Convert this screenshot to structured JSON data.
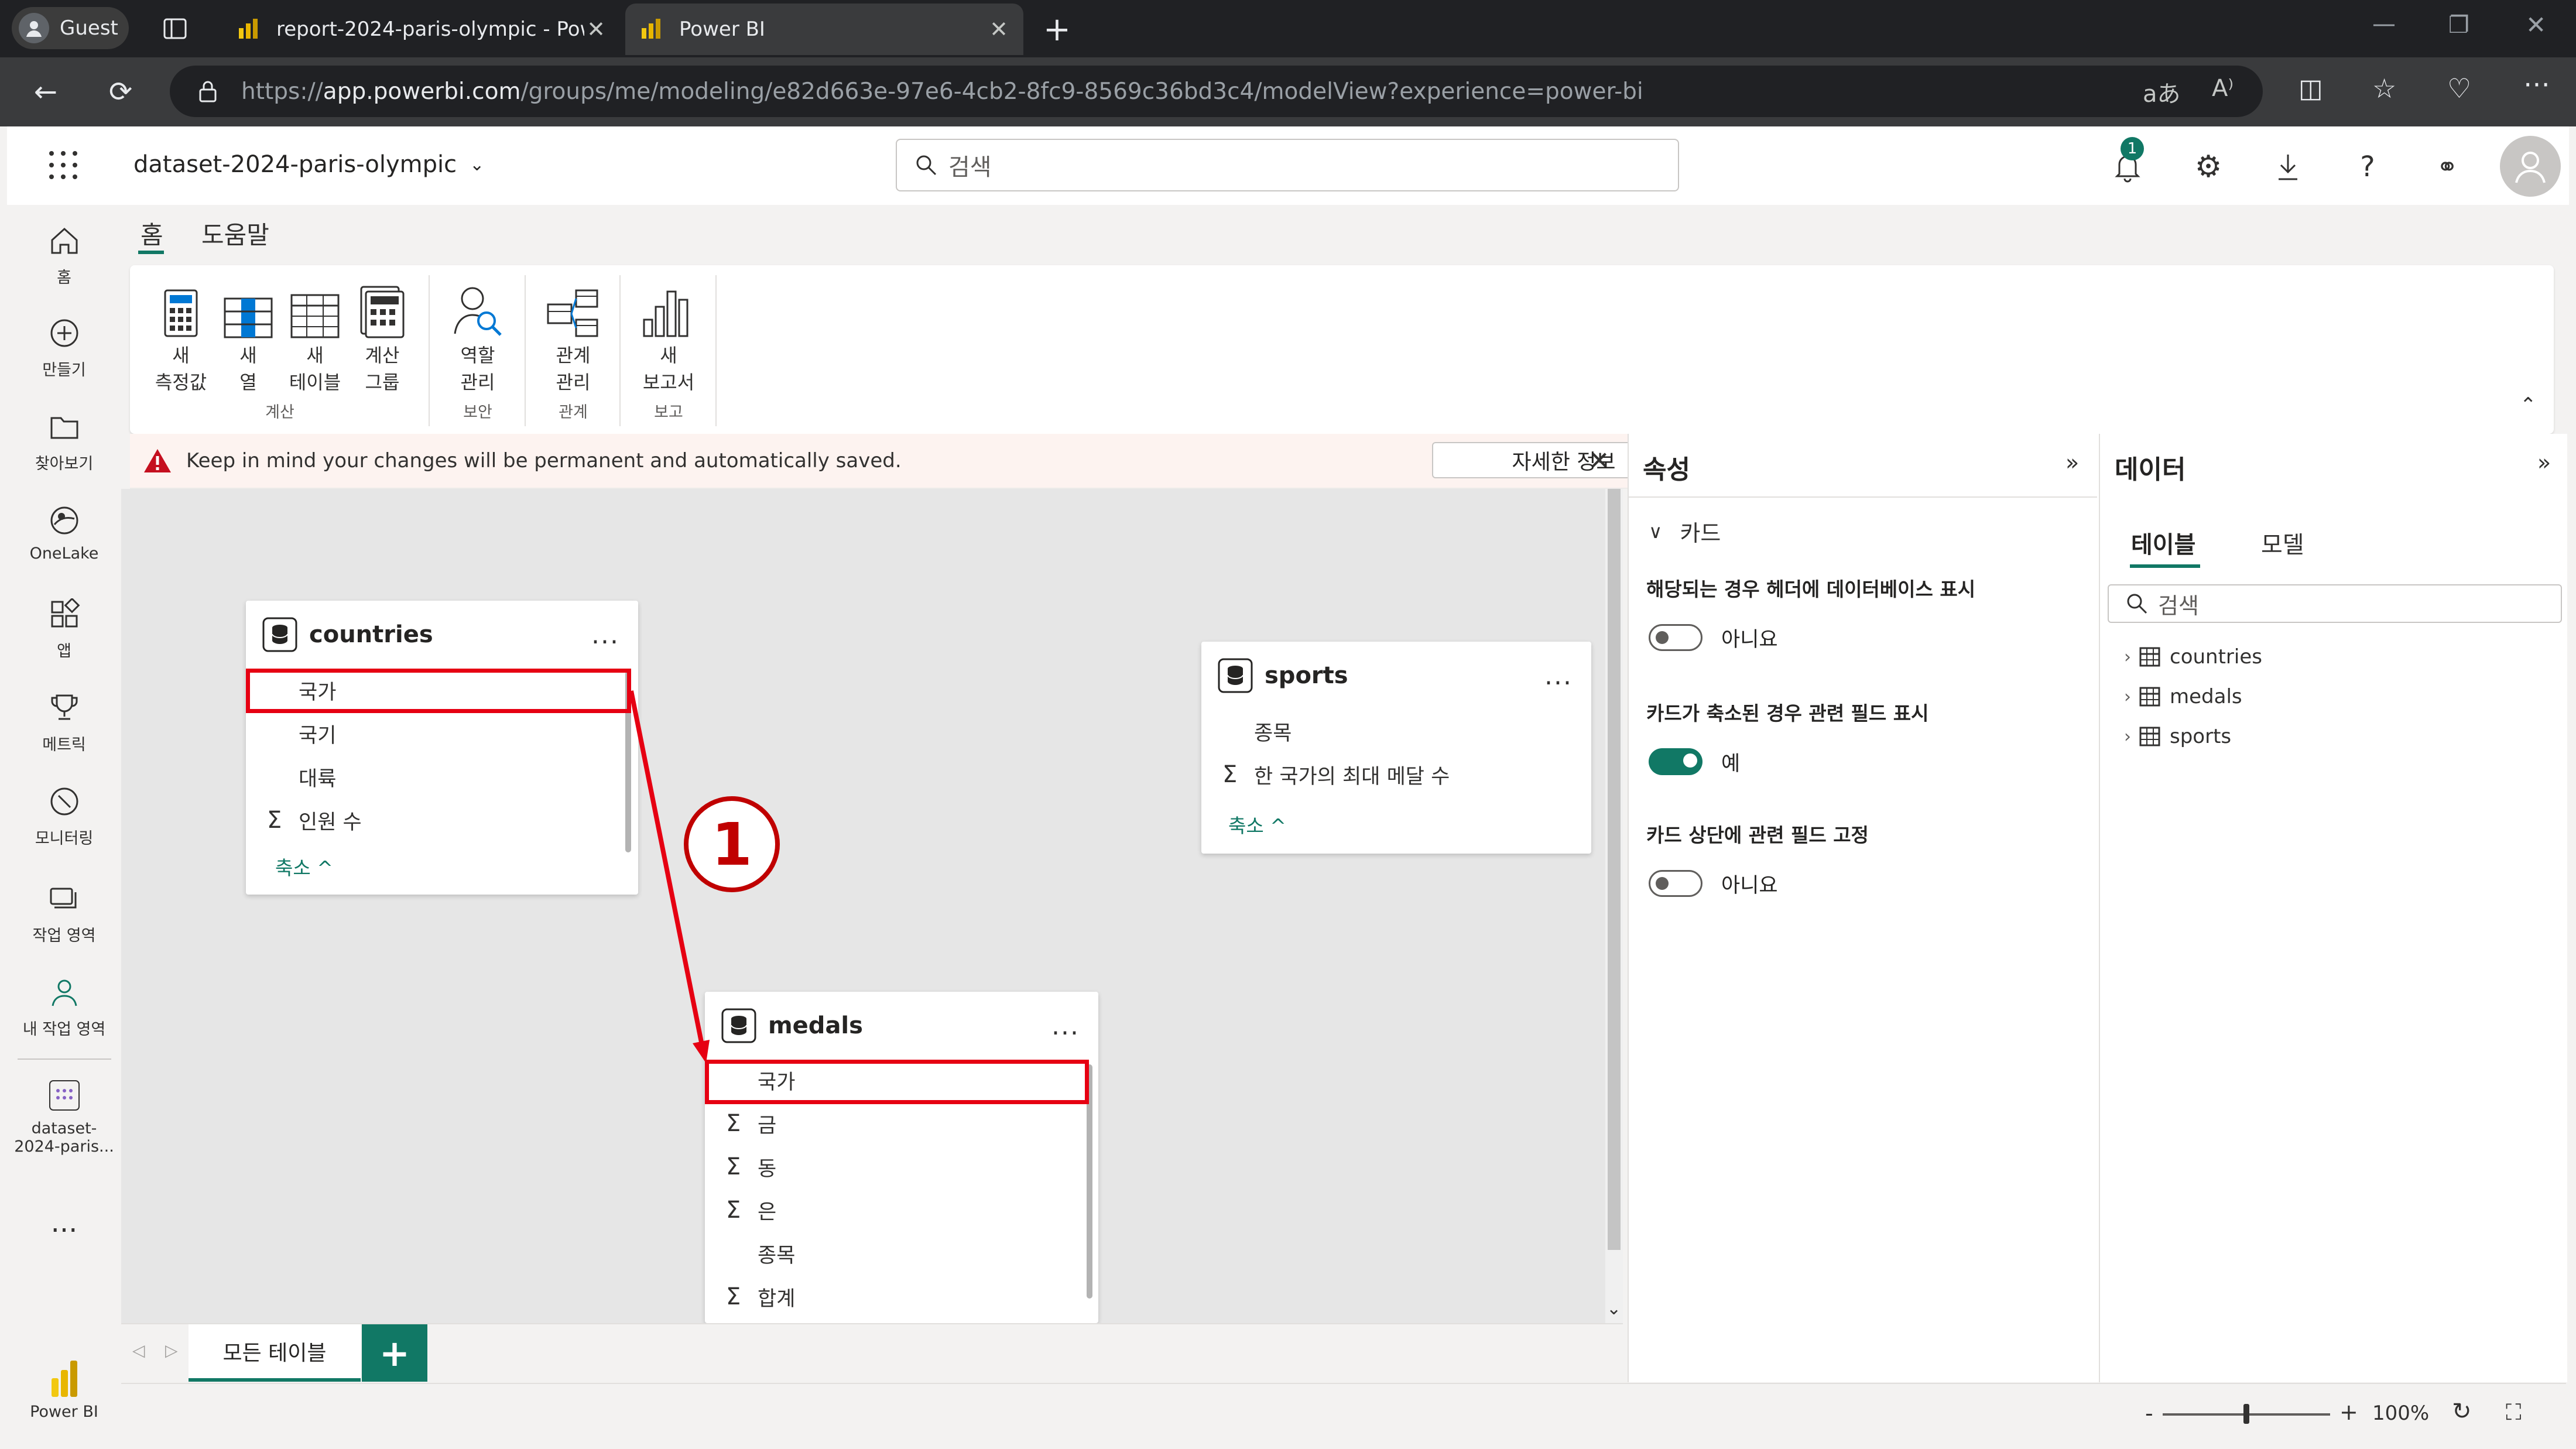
{
  "browser": {
    "profile_label": "Guest",
    "tabs": [
      {
        "title": "report-2024-paris-olympic - Power BI"
      },
      {
        "title": "Power BI"
      }
    ],
    "url_prefix": "https://",
    "url_host": "app.powerbi.com",
    "url_path": "/groups/me/modeling/e82d663e-97e6-4cb2-8fc9-8569c36bd3c4/modelView?experience=power-bi"
  },
  "header": {
    "dataset_name": "dataset-2024-paris-olympic",
    "search_placeholder": "검색",
    "notification_count": "1"
  },
  "left_nav": {
    "items": [
      {
        "label": "홈",
        "icon": "home-icon"
      },
      {
        "label": "만들기",
        "icon": "create-icon"
      },
      {
        "label": "찾아보기",
        "icon": "browse-icon"
      },
      {
        "label": "OneLake",
        "icon": "onelake-icon"
      },
      {
        "label": "앱",
        "icon": "apps-icon"
      },
      {
        "label": "메트릭",
        "icon": "metrics-icon"
      },
      {
        "label": "모니터링",
        "icon": "monitoring-icon"
      },
      {
        "label": "작업 영역",
        "icon": "workspaces-icon"
      },
      {
        "label": "내 작업 영역",
        "icon": "my-workspace-icon"
      }
    ],
    "dataset_item": {
      "line1": "dataset-",
      "line2": "2024-paris..."
    },
    "more": "...",
    "brand": "Power BI"
  },
  "ribbon": {
    "tabs": [
      {
        "label": "홈"
      },
      {
        "label": "도움말"
      }
    ],
    "buttons": [
      {
        "line1": "새",
        "line2": "측정값"
      },
      {
        "line1": "새",
        "line2": "열"
      },
      {
        "line1": "새",
        "line2": "테이블"
      },
      {
        "line1": "계산",
        "line2": "그룹"
      },
      {
        "line1": "역할",
        "line2": "관리"
      },
      {
        "line1": "관계",
        "line2": "관리"
      },
      {
        "line1": "새",
        "line2": "보고서"
      }
    ],
    "groups": [
      {
        "label": "계산"
      },
      {
        "label": "보안"
      },
      {
        "label": "관계"
      },
      {
        "label": "보고"
      }
    ]
  },
  "warning": {
    "message": "Keep in mind your changes will be permanent and automatically saved.",
    "more_button": "자세한 정보"
  },
  "tables": {
    "countries": {
      "name": "countries",
      "fields": [
        {
          "name": "국가",
          "sum": ""
        },
        {
          "name": "국기",
          "sum": ""
        },
        {
          "name": "대륙",
          "sum": ""
        },
        {
          "name": "인원 수",
          "sum": "Σ"
        }
      ],
      "collapse": "축소 ^"
    },
    "sports": {
      "name": "sports",
      "fields": [
        {
          "name": "종목",
          "sum": ""
        },
        {
          "name": "한 국가의 최대 메달 수",
          "sum": "Σ"
        }
      ],
      "collapse": "축소 ^"
    },
    "medals": {
      "name": "medals",
      "fields": [
        {
          "name": "국가",
          "sum": ""
        },
        {
          "name": "금",
          "sum": "Σ"
        },
        {
          "name": "동",
          "sum": "Σ"
        },
        {
          "name": "은",
          "sum": "Σ"
        },
        {
          "name": "종목",
          "sum": ""
        },
        {
          "name": "합계",
          "sum": "Σ"
        }
      ]
    },
    "more": "..."
  },
  "annotation": {
    "step": "1"
  },
  "canvas_tabs": {
    "all_tables": "모든 테이블",
    "add": "+"
  },
  "properties": {
    "title": "속성",
    "section": "카드",
    "settings": [
      {
        "label": "해당되는 경우 헤더에 데이터베이스 표시",
        "state": "off",
        "value": "아니요"
      },
      {
        "label": "카드가 축소된 경우 관련 필드 표시",
        "state": "on",
        "value": "예"
      },
      {
        "label": "카드 상단에 관련 필드 고정",
        "state": "off",
        "value": "아니요"
      }
    ]
  },
  "data_pane": {
    "title": "데이터",
    "tabs": [
      {
        "label": "테이블"
      },
      {
        "label": "모델"
      }
    ],
    "search_placeholder": "검색",
    "tables": [
      {
        "name": "countries"
      },
      {
        "name": "medals"
      },
      {
        "name": "sports"
      }
    ]
  },
  "status": {
    "zoom": "100%",
    "minus": "-",
    "plus": "+",
    "zoom_level": 0.5
  },
  "colors": {
    "accent": "#117865",
    "highlight": "#e60012",
    "powerbi_yellow": "#f2c811"
  }
}
